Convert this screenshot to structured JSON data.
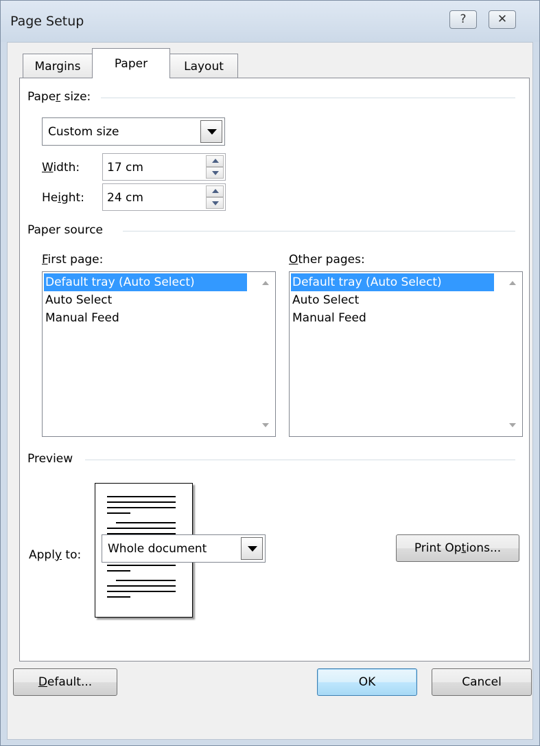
{
  "window": {
    "title": "Page Setup",
    "help_glyph": "?",
    "close_glyph": "✕"
  },
  "tabs": [
    {
      "label": "Margins",
      "selected": false
    },
    {
      "label": "Paper",
      "selected": true
    },
    {
      "label": "Layout",
      "selected": false
    }
  ],
  "paper_size": {
    "group_label_pre": "Pape",
    "group_label_mnemonic": "r",
    "group_label_post": " size:",
    "selected": "Custom size",
    "width_label_mnemonic": "W",
    "width_label_post": "idth:",
    "width_value": "17 cm",
    "height_label_pre": "He",
    "height_label_mnemonic": "i",
    "height_label_post": "ght:",
    "height_value": "24 cm"
  },
  "paper_source": {
    "group_label": "Paper source",
    "first_page_mnemonic": "F",
    "first_page_post": "irst page:",
    "other_pages_mnemonic": "O",
    "other_pages_post": "ther pages:",
    "first_page_items": [
      "Default tray (Auto Select)",
      "Auto Select",
      "Manual Feed"
    ],
    "other_pages_items": [
      "Default tray (Auto Select)",
      "Auto Select",
      "Manual Feed"
    ],
    "first_page_selected": "Default tray (Auto Select)",
    "other_pages_selected": "Default tray (Auto Select)"
  },
  "preview": {
    "group_label": "Preview"
  },
  "apply_to": {
    "label_pre": "Appl",
    "label_mnemonic": "y",
    "label_post": " to:",
    "value": "Whole document"
  },
  "buttons": {
    "print_options_pre": "Print Op",
    "print_options_mnemonic": "t",
    "print_options_post": "ions...",
    "default_mnemonic": "D",
    "default_post": "efault...",
    "ok": "OK",
    "cancel": "Cancel"
  },
  "colors": {
    "selection": "#3399ff",
    "dialog_frame": "#cfdbe9"
  }
}
